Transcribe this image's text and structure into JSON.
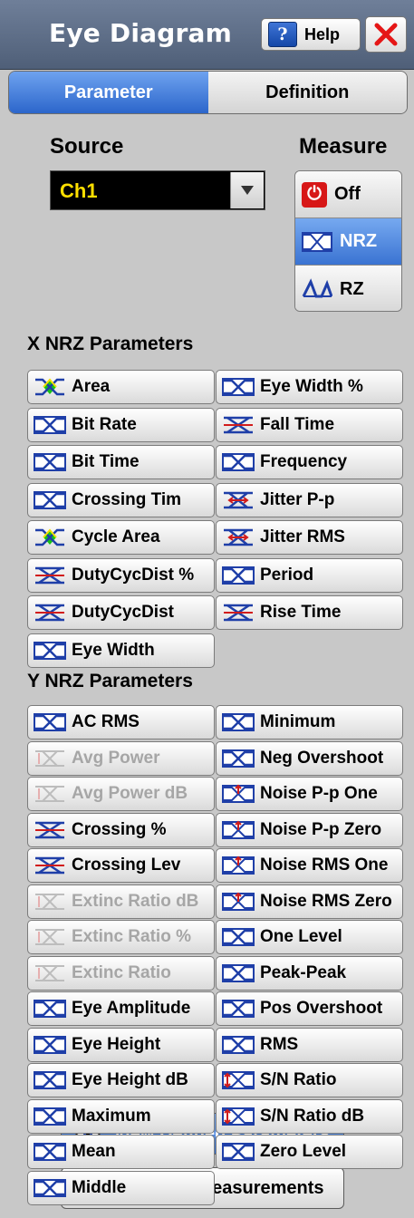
{
  "window": {
    "title": "Eye Diagram",
    "help_label": "Help"
  },
  "tabs": [
    {
      "label": "Parameter",
      "active": true
    },
    {
      "label": "Definition",
      "active": false
    }
  ],
  "source": {
    "label": "Source",
    "value": "Ch1"
  },
  "measure": {
    "label": "Measure",
    "options": [
      {
        "label": "Off",
        "icon": "power-icon",
        "selected": false
      },
      {
        "label": "NRZ",
        "icon": "nrz-eye-icon",
        "selected": true
      },
      {
        "label": "RZ",
        "icon": "rz-wave-icon",
        "selected": false
      }
    ]
  },
  "x_params": {
    "title": "X NRZ Parameters",
    "left": [
      {
        "label": "Area",
        "icon": "eye-area-icon"
      },
      {
        "label": "Bit Rate",
        "icon": "eye-icon"
      },
      {
        "label": "Bit Time",
        "icon": "eye-icon"
      },
      {
        "label": "Crossing Tim",
        "icon": "eye-icon"
      },
      {
        "label": "Cycle Area",
        "icon": "eye-area-icon"
      },
      {
        "label": "DutyCycDist %",
        "icon": "crossing-icon"
      },
      {
        "label": "DutyCycDist",
        "icon": "crossing-icon"
      },
      {
        "label": "Eye Width",
        "icon": "eye-icon"
      }
    ],
    "right": [
      {
        "label": "Eye Width %",
        "icon": "eye-icon"
      },
      {
        "label": "Fall Time",
        "icon": "crossing-icon"
      },
      {
        "label": "Frequency",
        "icon": "eye-icon"
      },
      {
        "label": "Jitter P-p",
        "icon": "jitter-icon"
      },
      {
        "label": "Jitter RMS",
        "icon": "jitter-icon"
      },
      {
        "label": "Period",
        "icon": "eye-icon"
      },
      {
        "label": "Rise Time",
        "icon": "crossing-icon"
      }
    ]
  },
  "y_params": {
    "title": "Y NRZ Parameters",
    "left": [
      {
        "label": "AC RMS",
        "icon": "eye-icon",
        "enabled": true
      },
      {
        "label": "Avg Power",
        "icon": "power-level-icon",
        "enabled": false
      },
      {
        "label": "Avg Power dB",
        "icon": "power-level-icon",
        "enabled": false
      },
      {
        "label": "Crossing %",
        "icon": "crossing-icon",
        "enabled": true
      },
      {
        "label": "Crossing Lev",
        "icon": "crossing-icon",
        "enabled": true
      },
      {
        "label": "Extinc Ratio dB",
        "icon": "power-level-icon",
        "enabled": false
      },
      {
        "label": "Extinc Ratio %",
        "icon": "power-level-icon",
        "enabled": false
      },
      {
        "label": "Extinc Ratio",
        "icon": "power-level-icon",
        "enabled": false
      },
      {
        "label": "Eye Amplitude",
        "icon": "eye-icon",
        "enabled": true
      },
      {
        "label": "Eye Height",
        "icon": "eye-icon",
        "enabled": true
      },
      {
        "label": "Eye Height dB",
        "icon": "eye-icon",
        "enabled": true
      },
      {
        "label": "Maximum",
        "icon": "eye-icon",
        "enabled": true
      },
      {
        "label": "Mean",
        "icon": "eye-icon",
        "enabled": true
      },
      {
        "label": "Middle",
        "icon": "eye-icon",
        "enabled": true
      }
    ],
    "right": [
      {
        "label": "Minimum",
        "icon": "eye-icon",
        "enabled": true
      },
      {
        "label": "Neg Overshoot",
        "icon": "eye-icon",
        "enabled": true
      },
      {
        "label": "Noise P-p One",
        "icon": "noise-icon",
        "enabled": true
      },
      {
        "label": "Noise P-p Zero",
        "icon": "noise-icon",
        "enabled": true
      },
      {
        "label": "Noise RMS One",
        "icon": "noise-icon",
        "enabled": true
      },
      {
        "label": "Noise RMS Zero",
        "icon": "noise-icon",
        "enabled": true
      },
      {
        "label": "One Level",
        "icon": "eye-icon",
        "enabled": true
      },
      {
        "label": "Peak-Peak",
        "icon": "eye-icon",
        "enabled": true
      },
      {
        "label": "Pos Overshoot",
        "icon": "eye-icon",
        "enabled": true
      },
      {
        "label": "RMS",
        "icon": "eye-icon",
        "enabled": true
      },
      {
        "label": "S/N Ratio",
        "icon": "snr-icon",
        "enabled": true
      },
      {
        "label": "S/N Ratio dB",
        "icon": "snr-icon",
        "enabled": true
      },
      {
        "label": "Zero Level",
        "icon": "eye-icon",
        "enabled": true
      }
    ]
  },
  "actions": {
    "view_label": "View Defined Parameters",
    "clear_label": "Clear All Measurements"
  },
  "colors": {
    "accent": "#2f6bd0",
    "disabled_text": "#a6a6a6",
    "source_text": "#ffdf00"
  }
}
